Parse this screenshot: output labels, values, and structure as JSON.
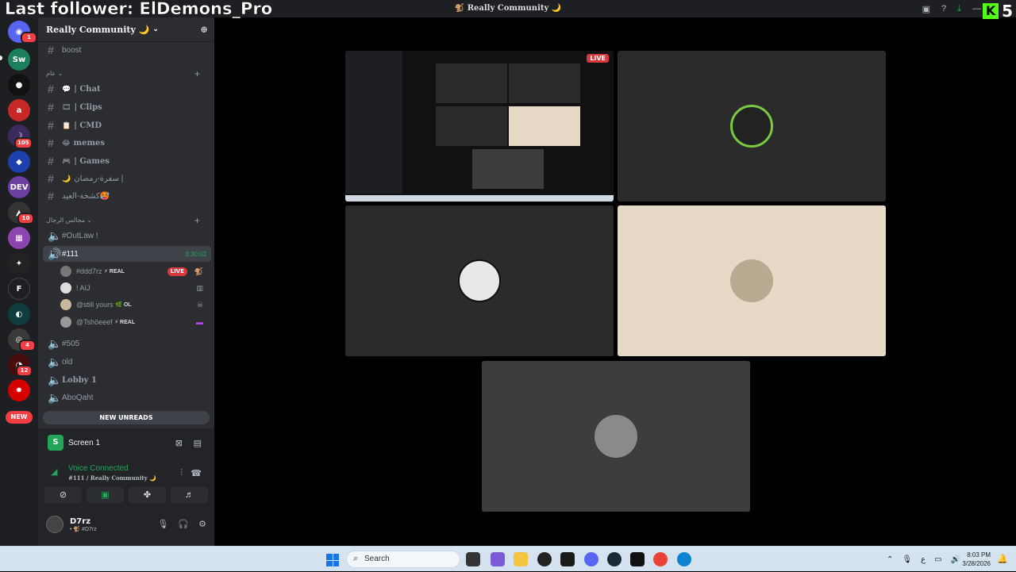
{
  "overlay": {
    "follower_text": "Last follower: ElDemons_Pro"
  },
  "titlebar": {
    "title": "🐒 Really Community 🌙"
  },
  "kick": {
    "logo": "K",
    "count": "5"
  },
  "rail": {
    "badges": {
      "dm": "1",
      "s5": "105",
      "s8": "10",
      "s13": "4",
      "s14": "12"
    },
    "new_label": "NEW"
  },
  "server": {
    "name": "Really Community 🌙"
  },
  "channels": {
    "boost": "boost",
    "cat1": "عام",
    "chat": "| Chat",
    "clips": "| Clips",
    "cmd": "| CMD",
    "memes": "memes",
    "games": "| Games",
    "ramadan": "سفرة-رمضان |",
    "kashta": "كشخة-العيد🥵",
    "cat2": "مجالس الرجال",
    "outlaw": "#OutLaw !",
    "v111": "#111",
    "v111_time": "3:30:03",
    "v505": "#505",
    "old": "old",
    "lobby": "Lobby 1",
    "aboqaht": "AboQaht"
  },
  "voice_users": [
    {
      "name": "#ddd7rz",
      "tag": "⚡ REAL",
      "live": "LIVE"
    },
    {
      "name": "! AIJ",
      "tag": ""
    },
    {
      "name": "@still yours",
      "tag": "🌿 OL"
    },
    {
      "name": "@Tshöeeef",
      "tag": "⚡ REAL"
    }
  ],
  "new_unreads": "NEW UNREADS",
  "panel": {
    "screen": "Screen 1",
    "voice_status": "Voice Connected",
    "voice_channel": "#111 / Really Community 🌙"
  },
  "user": {
    "name": "D7rz",
    "tag": "• 🐒 #D7rz"
  },
  "stage": {
    "live_tag": "LIVE"
  },
  "taskbar": {
    "search_placeholder": "Search",
    "time": "8:03 PM",
    "date": "3/28/2026",
    "lang": "ع"
  },
  "colors": {
    "accent_green": "#23a55a",
    "live_red": "#da373c",
    "sidebar": "#2b2d31"
  }
}
